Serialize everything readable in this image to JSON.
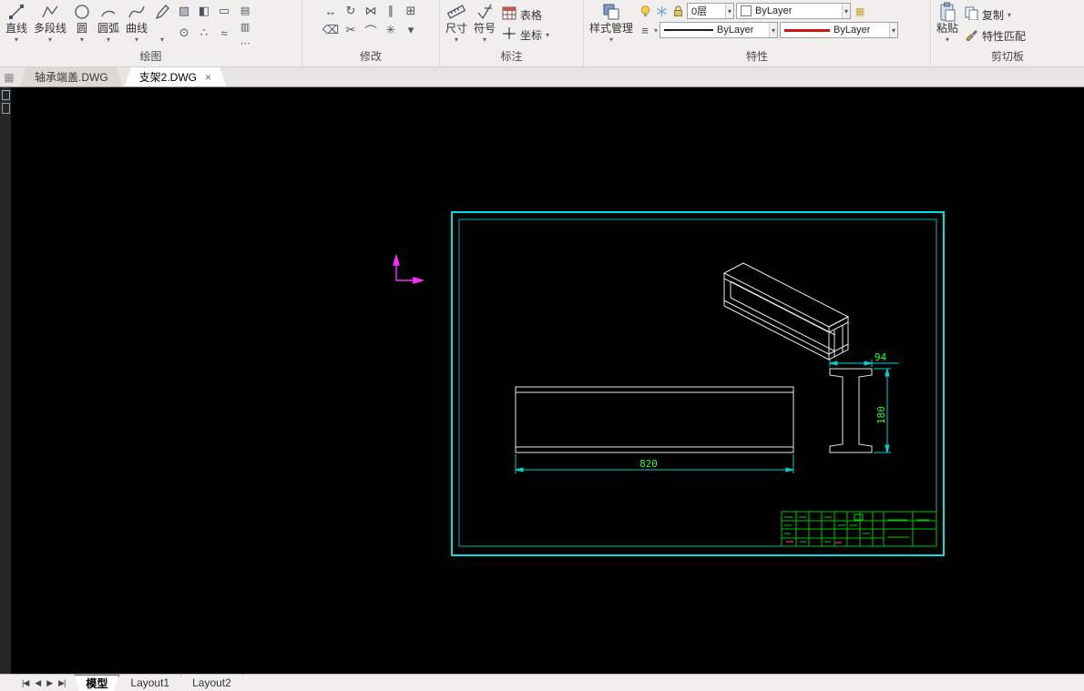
{
  "ui": {
    "dd": "▾",
    "close": "×"
  },
  "ribbon": {
    "groups": {
      "draw": {
        "label": "绘图",
        "buttons": [
          {
            "label": "直线"
          },
          {
            "label": "多段线"
          },
          {
            "label": "圆"
          },
          {
            "label": "圆弧"
          },
          {
            "label": "曲线"
          }
        ]
      },
      "modify": {
        "label": "修改"
      },
      "annotate": {
        "label": "标注",
        "buttons": [
          {
            "label": "尺寸"
          },
          {
            "label": "符号"
          },
          {
            "label": "表格"
          },
          {
            "label": "坐标"
          }
        ]
      },
      "properties": {
        "label": "特性",
        "style_manager": "样式管理",
        "layer_value": "0层",
        "color_value": "ByLayer",
        "linetype_value": "ByLayer",
        "lineweight_value": "ByLayer"
      },
      "clipboard": {
        "label": "剪切板",
        "paste": "粘贴",
        "copy": "复制",
        "match": "特性匹配"
      }
    }
  },
  "file_tabs": {
    "tabs": [
      {
        "label": "轴承端盖.DWG"
      },
      {
        "label": "支架2.DWG"
      }
    ]
  },
  "drawing": {
    "dims": {
      "flange_width": "94",
      "section_depth": "180",
      "beam_length": "820"
    },
    "colors": {
      "frame": "#00e0e0",
      "dimension_line": "#00cfcf",
      "dimension_text": "#27ff27",
      "geometry": "#e8e8e8",
      "ucs": "#ff2bff",
      "title_block": "#00c400"
    }
  },
  "layout_bar": {
    "nav": {
      "first": "|◀",
      "prev": "◀",
      "next": "▶",
      "last": "▶|"
    },
    "tabs": [
      {
        "label": "模型"
      },
      {
        "label": "Layout1"
      },
      {
        "label": "Layout2"
      }
    ]
  }
}
